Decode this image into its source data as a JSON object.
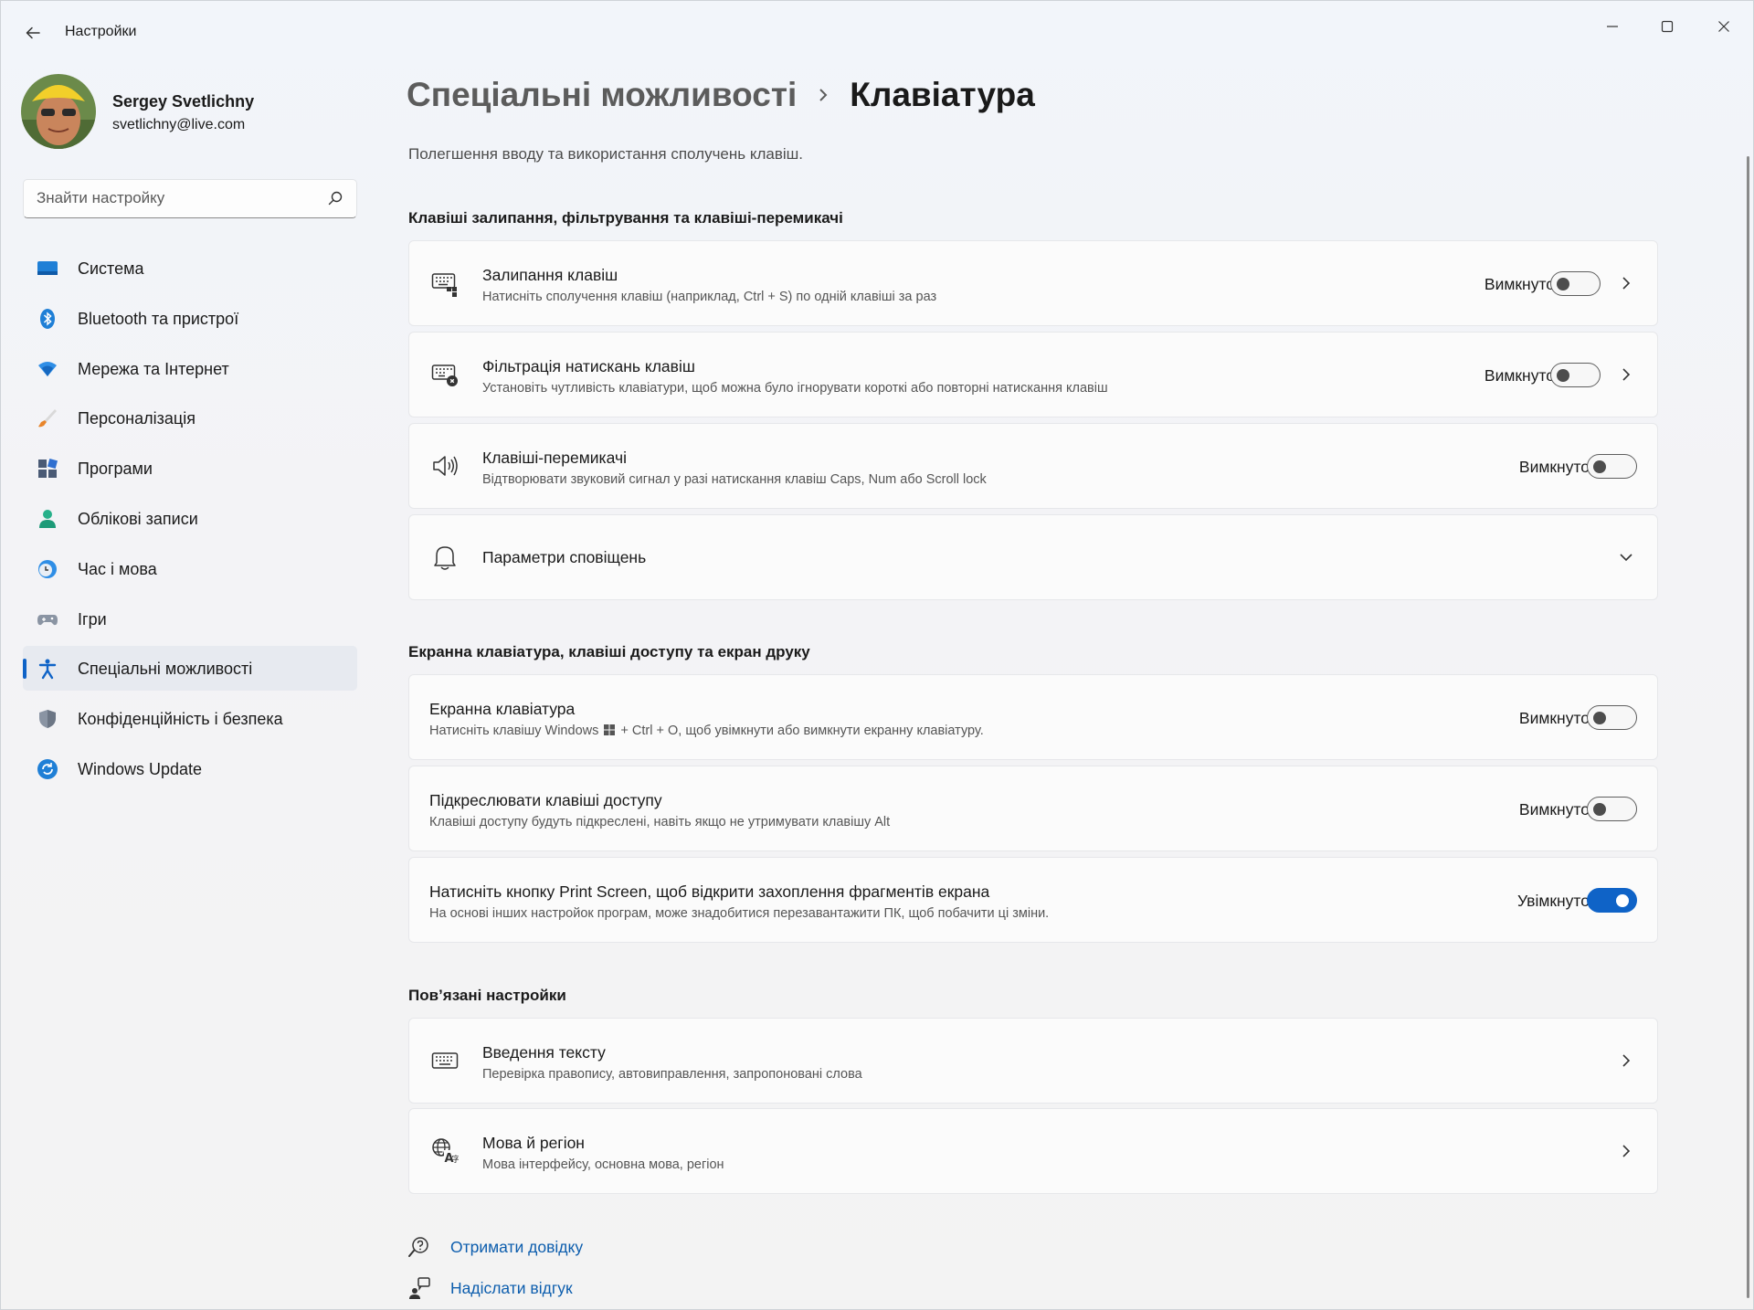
{
  "window": {
    "app_title": "Настройки"
  },
  "profile": {
    "name": "Sergey Svetlichny",
    "email": "svetlichny@live.com"
  },
  "search": {
    "placeholder": "Знайти настройку"
  },
  "sidebar": {
    "items": [
      {
        "label": "Система",
        "icon": "monitor-icon"
      },
      {
        "label": "Bluetooth та пристрої",
        "icon": "bluetooth-icon"
      },
      {
        "label": "Мережа та Інтернет",
        "icon": "wifi-icon"
      },
      {
        "label": "Персоналізація",
        "icon": "brush-icon"
      },
      {
        "label": "Програми",
        "icon": "apps-icon"
      },
      {
        "label": "Облікові записи",
        "icon": "person-icon"
      },
      {
        "label": "Час і мова",
        "icon": "clock-globe-icon"
      },
      {
        "label": "Ігри",
        "icon": "gamepad-icon"
      },
      {
        "label": "Спеціальні можливості",
        "icon": "accessibility-icon",
        "active": true
      },
      {
        "label": "Конфіденційність і безпека",
        "icon": "shield-icon"
      },
      {
        "label": "Windows Update",
        "icon": "update-icon"
      }
    ]
  },
  "breadcrumb": {
    "parent": "Спеціальні можливості",
    "current": "Клавіатура"
  },
  "page_description": "Полегшення вводу та використання сполучень клавіш.",
  "sections": {
    "sticky": {
      "title": "Клавіші залипання, фільтрування та клавіші-перемикачі",
      "rows": [
        {
          "title": "Залипання клавіш",
          "subtitle": "Натисніть сполучення клавіш (наприклад, Ctrl + S) по одній клавіші за раз",
          "state": "Вимкнуто",
          "on": false
        },
        {
          "title": "Фільтрація натискань клавіш",
          "subtitle": "Установіть чутливість клавіатури, щоб можна було ігнорувати короткі або повторні натискання клавіш",
          "state": "Вимкнуто",
          "on": false
        },
        {
          "title": "Клавіші-перемикачі",
          "subtitle": "Відтворювати звуковий сигнал у разі натискання клавіш Caps, Num або Scroll lock",
          "state": "Вимкнуто",
          "on": false
        },
        {
          "title": "Параметри сповіщень"
        }
      ]
    },
    "onscreen": {
      "title": "Екранна клавіатура, клавіші доступу та екран друку",
      "rows": [
        {
          "title": "Екранна клавіатура",
          "subtitle_a": "Натисніть клавішу Windows",
          "subtitle_b": "+ Ctrl + O, щоб увімкнути або вимкнути екранну клавіатуру.",
          "state": "Вимкнуто",
          "on": false
        },
        {
          "title": "Підкреслювати клавіші доступу",
          "subtitle": "Клавіші доступу будуть підкреслені, навіть якщо не утримувати клавішу Alt",
          "state": "Вимкнуто",
          "on": false
        },
        {
          "title": "Натисніть кнопку Print Screen, щоб відкрити захоплення фрагментів екрана",
          "subtitle": "На основі інших настройок програм, може знадобитися перезавантажити ПК, щоб побачити ці зміни.",
          "state": "Увімкнуто",
          "on": true
        }
      ]
    },
    "related": {
      "title": "Пов’язані настройки",
      "rows": [
        {
          "title": "Введення тексту",
          "subtitle": "Перевірка правопису, автовиправлення, запропоновані слова"
        },
        {
          "title": "Мова й регіон",
          "subtitle": "Мова інтерфейсу, основна мова, регіон"
        }
      ]
    }
  },
  "links": {
    "help": "Отримати довідку",
    "feedback": "Надіслати відгук"
  },
  "colors": {
    "accent": "#0f63c7",
    "link": "#0c5dad"
  }
}
